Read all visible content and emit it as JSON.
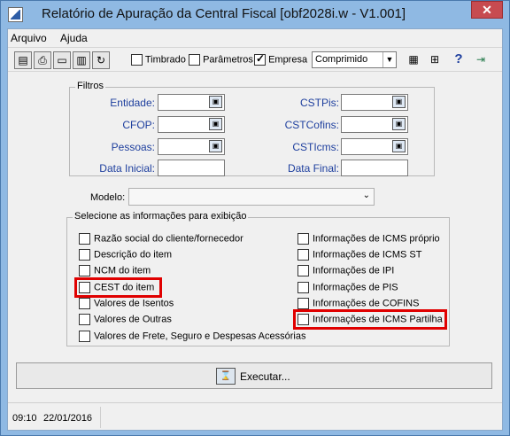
{
  "window": {
    "title": "Relatório de Apuração da Central Fiscal [obf2028i.w - V1.001]",
    "close_label": "✕"
  },
  "menu": {
    "items": [
      "Arquivo",
      "Ajuda"
    ]
  },
  "toolbar": {
    "timbrado_label": "Timbrado",
    "parametros_label": "Parâmetros",
    "empresa_label": "Empresa",
    "empresa_checked": true,
    "print_mode": "Comprimido",
    "icons": [
      "new-document-icon",
      "printer-icon",
      "open-folder-icon",
      "save-folder-icon",
      "refresh-icon",
      "calculator-icon",
      "query-icon",
      "help-icon",
      "exit-icon"
    ],
    "help_glyph": "?"
  },
  "filtros": {
    "title": "Filtros",
    "entidade": "Entidade:",
    "cfop": "CFOP:",
    "pessoas": "Pessoas:",
    "data_inicial": "Data Inicial:",
    "cstpis": "CSTPis:",
    "cstcofins": "CSTCofins:",
    "csticms": "CSTIcms:",
    "data_final": "Data Final:"
  },
  "modelo": {
    "label": "Modelo:",
    "value": ""
  },
  "exibicao": {
    "title": "Selecione as informações para exibição",
    "left": [
      "Razão social do cliente/fornecedor",
      "Descrição do item",
      "NCM do item",
      "CEST do item",
      "Valores de Isentos",
      "Valores de Outras",
      "Valores de Frete, Seguro e Despesas Acessórias"
    ],
    "right": [
      "Informações de ICMS próprio",
      "Informações de ICMS ST",
      "Informações de IPI",
      "Informações de PIS",
      "Informações de COFINS",
      "Informações de ICMS Partilha"
    ]
  },
  "execute": {
    "label": "Executar..."
  },
  "status": {
    "time": "09:10",
    "date": "22/01/2016"
  },
  "colors": {
    "highlight": "#e00000",
    "label_blue": "#1e3f9e",
    "title_bar": "#8fb9e3"
  }
}
